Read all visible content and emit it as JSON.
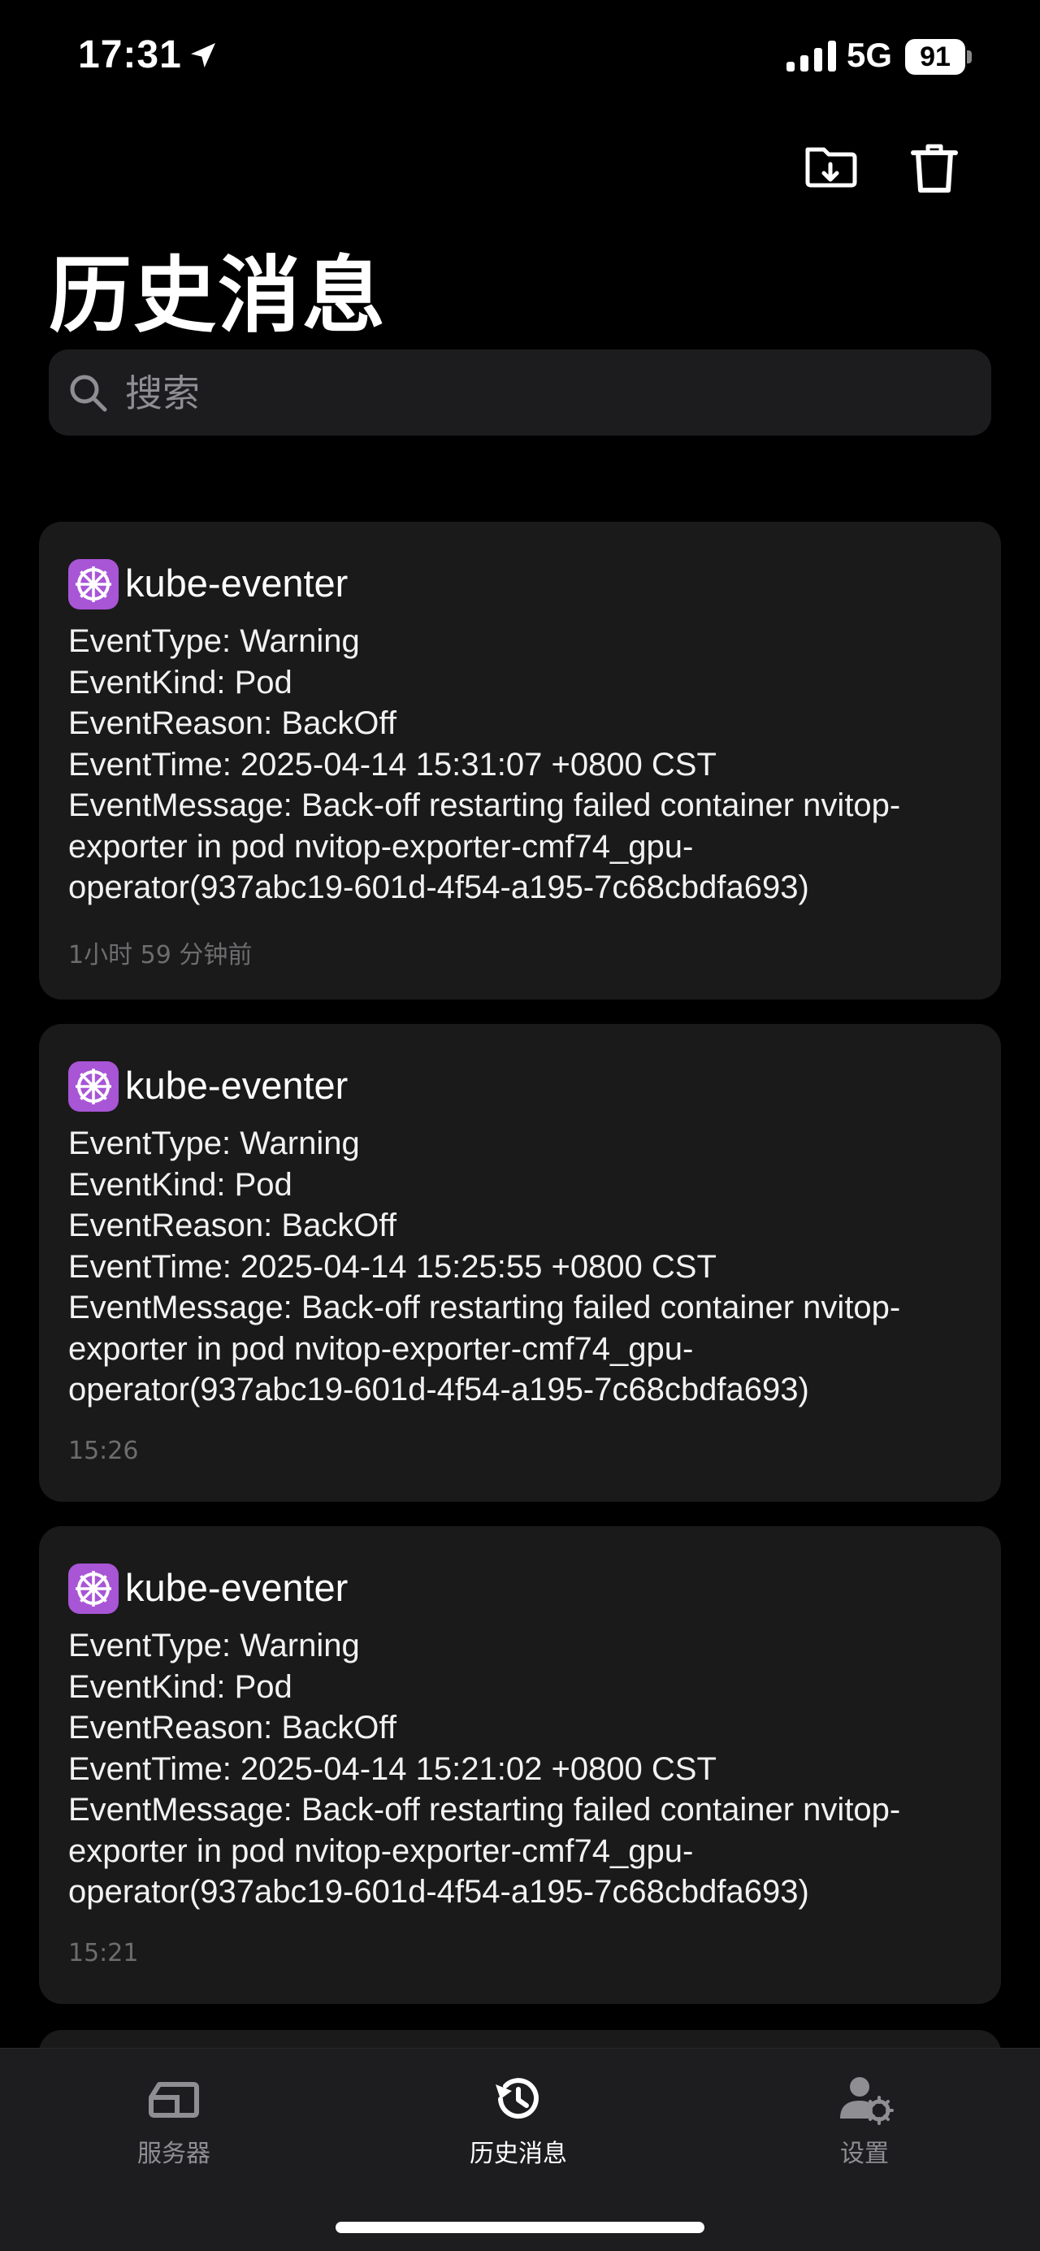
{
  "status_bar": {
    "time": "17:31",
    "network": "5G",
    "battery": "91"
  },
  "header": {
    "title": "历史消息"
  },
  "search": {
    "placeholder": "搜索"
  },
  "messages": [
    {
      "source": "kube-eventer",
      "event_type": "EventType:  Warning",
      "event_kind": "EventKind:  Pod",
      "event_reason": "EventReason:  BackOff",
      "event_time": "EventTime:  2025-04-14 15:31:07 +0800 CST",
      "event_message": "EventMessage:  Back-off restarting failed container nvitop-exporter in pod nvitop-exporter-cmf74_gpu-operator(937abc19-601d-4f54-a195-7c68cbdfa693)",
      "timestamp": "1小时 59 分钟前"
    },
    {
      "source": "kube-eventer",
      "event_type": "EventType:  Warning",
      "event_kind": "EventKind:  Pod",
      "event_reason": "EventReason:  BackOff",
      "event_time": "EventTime:  2025-04-14 15:25:55 +0800 CST",
      "event_message": "EventMessage:  Back-off restarting failed container nvitop-exporter in pod nvitop-exporter-cmf74_gpu-operator(937abc19-601d-4f54-a195-7c68cbdfa693)",
      "timestamp": "15:26"
    },
    {
      "source": "kube-eventer",
      "event_type": "EventType:  Warning",
      "event_kind": "EventKind:  Pod",
      "event_reason": "EventReason:  BackOff",
      "event_time": "EventTime:  2025-04-14 15:21:02 +0800 CST",
      "event_message": "EventMessage:  Back-off restarting failed container nvitop-exporter in pod nvitop-exporter-cmf74_gpu-operator(937abc19-601d-4f54-a195-7c68cbdfa693)",
      "timestamp": "15:21"
    }
  ],
  "tabbar": {
    "items": [
      {
        "label": "服务器",
        "icon": "server-icon",
        "active": false
      },
      {
        "label": "历史消息",
        "icon": "history-icon",
        "active": true
      },
      {
        "label": "设置",
        "icon": "user-gear-icon",
        "active": false
      }
    ]
  },
  "colors": {
    "background": "#000000",
    "card": "#1a1a1a",
    "search_bg": "#1c1c1e",
    "tab_active": "#ffffff",
    "tab_inactive": "#8e8e93",
    "k8s_icon_bg": "#a855d6"
  }
}
